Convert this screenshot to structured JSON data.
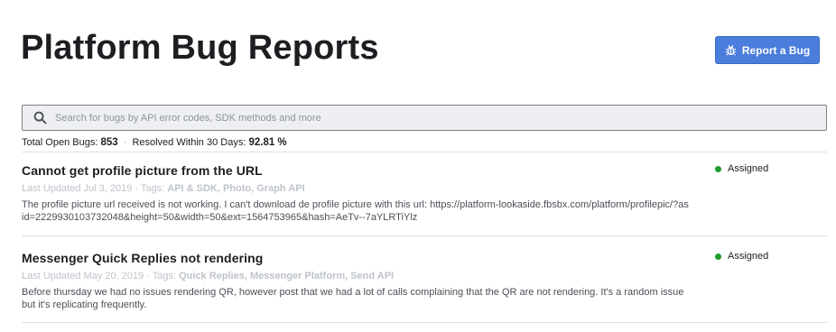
{
  "header": {
    "title": "Platform Bug Reports",
    "report_button_label": "Report a Bug",
    "report_button_icon": "bug-icon",
    "report_button_color": "#4a7ddc"
  },
  "search": {
    "placeholder": "Search for bugs by API error codes, SDK methods and more",
    "value": "",
    "icon": "search-icon"
  },
  "stats": {
    "open_label": "Total Open Bugs:",
    "open_value": "853",
    "separator": "·",
    "resolved_label": "Resolved Within 30 Days:",
    "resolved_value": "92.81 %"
  },
  "bugs": [
    {
      "title": "Cannot get profile picture from the URL",
      "updated": "Last Updated Jul 3, 2019",
      "tags_label": "· Tags:",
      "tags": "API & SDK, Photo, Graph API",
      "description": "The profile picture url received is not working. I can't download de profile picture with this url: https://platform-lookaside.fbsbx.com/platform/profilepic/?asid=2229930103732048&height=50&width=50&ext=1564753965&hash=AeTv--7aYLRTiYlz",
      "status": "Assigned",
      "status_color": "#1d9a2c"
    },
    {
      "title": "Messenger Quick Replies not rendering",
      "updated": "Last Updated May 20, 2019",
      "tags_label": "· Tags:",
      "tags": "Quick Replies, Messenger Platform, Send API",
      "description": "Before thursday we had no issues rendering QR, however post that we had a lot of calls complaining that the QR are not rendering. It's a random issue but it's replicating frequently.",
      "status": "Assigned",
      "status_color": "#1d9a2c"
    }
  ]
}
